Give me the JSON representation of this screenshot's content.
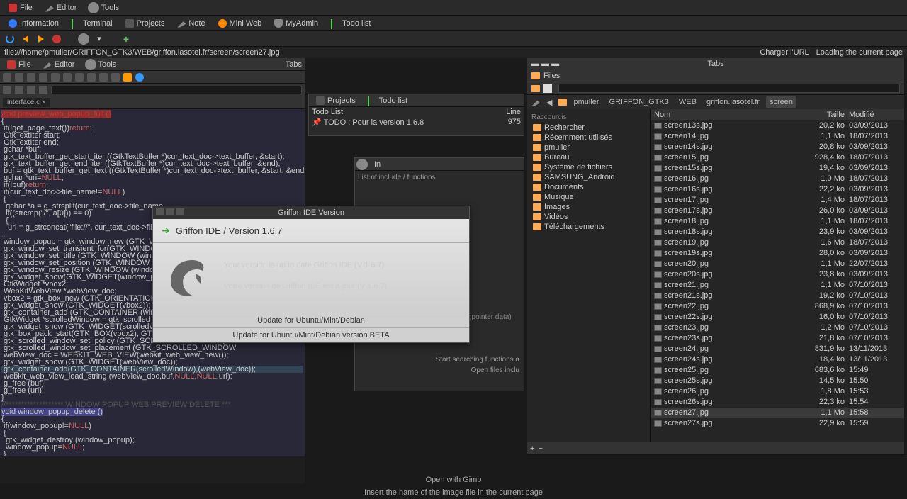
{
  "menubar1": {
    "file": "File",
    "editor": "Editor",
    "tools": "Tools"
  },
  "menubar2": {
    "information": "Information",
    "terminal": "Terminal",
    "projects": "Projects",
    "note": "Note",
    "miniweb": "Mini Web",
    "myadmin": "MyAdmin",
    "todolist": "Todo list"
  },
  "url": "file:///home/pmuller/GRIFFON_GTK3/WEB/griffon.lasotel.fr/screen/screen27.jpg",
  "url_actions": {
    "charger": "Charger l'URL",
    "loading": "Loading the current page"
  },
  "left_menubar": {
    "file": "File",
    "editor": "Editor",
    "tools": "Tools",
    "tabs": "Tabs"
  },
  "code_tab": "interface.c ×",
  "code_lines": [
    "void preview_web_popup_full ()",
    "{",
    " if(!get_page_text())return;",
    "",
    " GtkTextIter start;",
    " GtkTextIter end;",
    " gchar *buf;",
    " gtk_text_buffer_get_start_iter ((GtkTextBuffer *)cur_text_doc->text_buffer, &start);",
    " gtk_text_buffer_get_end_iter ((GtkTextBuffer *)cur_text_doc->text_buffer, &end);",
    " buf = gtk_text_buffer_get_text ((GtkTextBuffer *)cur_text_doc->text_buffer, &start, &end, FALSE);",
    "",
    " gchar *uri=NULL;",
    "",
    " if(!buf)return;",
    "",
    " if(cur_text_doc->file_name!=NULL)",
    " {",
    "  gchar *a = g_strsplit(cur_text_doc->file_name,",
    "  if((strcmp(\"/\", a[0])) == 0)",
    "  {",
    "   uri = g_strconcat(\"file://\", cur_text_doc->file_name,NULL);"
  ],
  "midpanel1": {
    "projects": "Projects",
    "todolist": "Todo list",
    "todo_col": "Todo List",
    "line_col": "Line",
    "todo_item": "TODO : Pour la version 1.6.8",
    "todo_line": "975"
  },
  "midpanel2": {
    "in": "In",
    "list_h": "List of include / functions",
    "start1": "Start searching functions a",
    "start2": "Open files inclu",
    "dummy": "gpointer data)"
  },
  "filemgr": {
    "tabs_title": "Tabs",
    "files_tab": "Files",
    "path": [
      "pmuller",
      "GRIFFON_GTK3",
      "WEB",
      "griffon.lasotel.fr",
      "screen"
    ],
    "side_h1": "Raccourcis",
    "side": [
      {
        "label": "Rechercher",
        "ico": "search"
      },
      {
        "label": "Récemment utilisés",
        "ico": "clock"
      },
      {
        "label": "pmuller",
        "ico": "folder"
      },
      {
        "label": "Bureau",
        "ico": "desktop"
      },
      {
        "label": "Système de fichiers",
        "ico": "disk"
      },
      {
        "label": "SAMSUNG_Android",
        "ico": "device"
      },
      {
        "label": "Documents",
        "ico": "folder"
      },
      {
        "label": "Musique",
        "ico": "folder"
      },
      {
        "label": "Images",
        "ico": "folder"
      },
      {
        "label": "Vidéos",
        "ico": "folder"
      },
      {
        "label": "Téléchargements",
        "ico": "folder"
      }
    ],
    "cols": {
      "name": "Nom",
      "size": "Taille",
      "mod": "Modifié"
    },
    "rows": [
      {
        "n": "screen13s.jpg",
        "s": "20,2 ko",
        "m": "03/09/2013"
      },
      {
        "n": "screen14.jpg",
        "s": "1,1 Mo",
        "m": "18/07/2013"
      },
      {
        "n": "screen14s.jpg",
        "s": "20,8 ko",
        "m": "03/09/2013"
      },
      {
        "n": "screen15.jpg",
        "s": "928,4 ko",
        "m": "18/07/2013"
      },
      {
        "n": "screen15s.jpg",
        "s": "19,4 ko",
        "m": "03/09/2013"
      },
      {
        "n": "screen16.jpg",
        "s": "1,0 Mo",
        "m": "18/07/2013"
      },
      {
        "n": "screen16s.jpg",
        "s": "22,2 ko",
        "m": "03/09/2013"
      },
      {
        "n": "screen17.jpg",
        "s": "1,4 Mo",
        "m": "18/07/2013"
      },
      {
        "n": "screen17s.jpg",
        "s": "26,0 ko",
        "m": "03/09/2013"
      },
      {
        "n": "screen18.jpg",
        "s": "1,1 Mo",
        "m": "18/07/2013"
      },
      {
        "n": "screen18s.jpg",
        "s": "23,9 ko",
        "m": "03/09/2013"
      },
      {
        "n": "screen19.jpg",
        "s": "1,6 Mo",
        "m": "18/07/2013"
      },
      {
        "n": "screen19s.jpg",
        "s": "28,0 ko",
        "m": "03/09/2013"
      },
      {
        "n": "screen20.jpg",
        "s": "1,1 Mo",
        "m": "22/07/2013"
      },
      {
        "n": "screen20s.jpg",
        "s": "23,8 ko",
        "m": "03/09/2013"
      },
      {
        "n": "screen21.jpg",
        "s": "1,1 Mo",
        "m": "07/10/2013"
      },
      {
        "n": "screen21s.jpg",
        "s": "19,2 ko",
        "m": "07/10/2013"
      },
      {
        "n": "screen22.jpg",
        "s": "868,9 ko",
        "m": "07/10/2013"
      },
      {
        "n": "screen22s.jpg",
        "s": "16,0 ko",
        "m": "07/10/2013"
      },
      {
        "n": "screen23.jpg",
        "s": "1,2 Mo",
        "m": "07/10/2013"
      },
      {
        "n": "screen23s.jpg",
        "s": "21,8 ko",
        "m": "07/10/2013"
      },
      {
        "n": "screen24.jpg",
        "s": "831,9 ko",
        "m": "13/11/2013"
      },
      {
        "n": "screen24s.jpg",
        "s": "18,4 ko",
        "m": "13/11/2013"
      },
      {
        "n": "screen25.jpg",
        "s": "683,6 ko",
        "m": "15:49"
      },
      {
        "n": "screen25s.jpg",
        "s": "14,5 ko",
        "m": "15:50"
      },
      {
        "n": "screen26.jpg",
        "s": "1,8 Mo",
        "m": "15:53"
      },
      {
        "n": "screen26s.jpg",
        "s": "22,3 ko",
        "m": "15:54"
      },
      {
        "n": "screen27.jpg",
        "s": "1,1 Mo",
        "m": "15:58",
        "sel": true
      },
      {
        "n": "screen27s.jpg",
        "s": "22,9 ko",
        "m": "15:59"
      }
    ]
  },
  "dialog": {
    "winTitle": "Griffon IDE Version",
    "title": "Griffon IDE / Version 1.6.7",
    "line1": "Your version is up to date Griffon IDE (V 1.6.7).",
    "line2": "Votre version de Griffon IDE est à jour (V 1.6.7).",
    "btn1": "Update for Ubuntu/Mint/Debian",
    "btn2": "Update for Ubuntu/Mint/Debian version BETA"
  },
  "status": {
    "gimp": "Open with Gimp",
    "insert": "Insert the name of the image file in the current page"
  }
}
